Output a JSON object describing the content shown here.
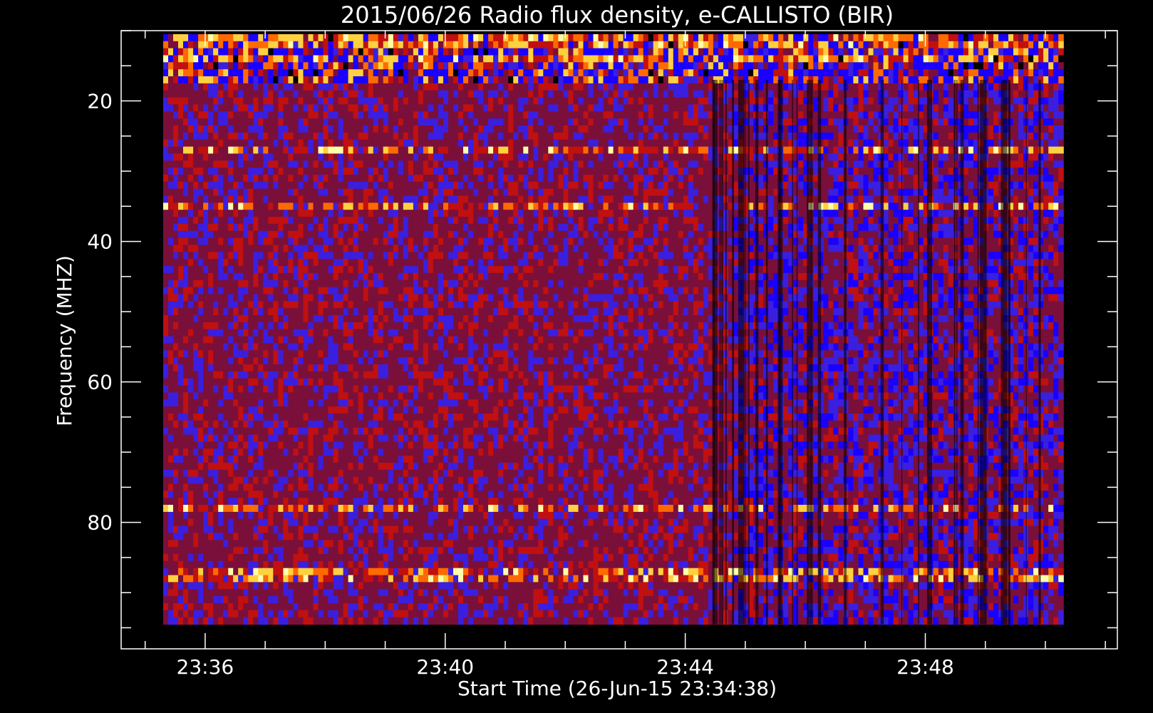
{
  "chart_data": {
    "type": "heatmap",
    "title": "2015/06/26  Radio flux density, e-CALLISTO (BIR)",
    "xlabel": "Start Time (26-Jun-15 23:34:38)",
    "ylabel": "Frequency (MHZ)",
    "x_ticks": [
      "23:36",
      "23:40",
      "23:44",
      "23:48"
    ],
    "y_ticks": [
      "20",
      "40",
      "60",
      "80"
    ],
    "y_tick_values": [
      20,
      40,
      60,
      80
    ],
    "x_tick_minutes": [
      36,
      40,
      44,
      48
    ],
    "xlim_minutes": [
      34.6,
      51.2
    ],
    "data_x_range_minutes": [
      35.3,
      50.3
    ],
    "ylim": [
      10,
      98
    ],
    "y_inverted": true,
    "data_y_range": [
      10.5,
      94.5
    ],
    "colormap": [
      "#000000",
      "#1a00ff",
      "#3a1fe0",
      "#7a0f3a",
      "#c01010",
      "#ff6a00",
      "#ffd040",
      "#ffffaa"
    ],
    "background": "#000000",
    "grid": false,
    "bright_bands_mhz": [
      11.5,
      14,
      27,
      35,
      78,
      87.5
    ],
    "quiet_level": 0.45
  }
}
